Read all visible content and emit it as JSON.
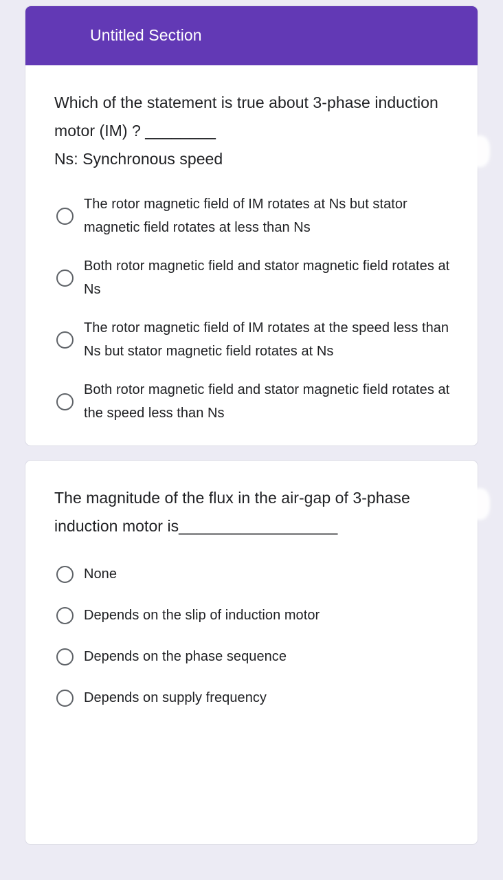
{
  "theme": {
    "page_background": "#ecebf4",
    "card_background": "#ffffff",
    "section_header_color": "#6239b5",
    "text_color": "#202124",
    "radio_border_color": "#5f6368"
  },
  "section": {
    "title": "Untitled Section"
  },
  "questions": [
    {
      "id": "q1",
      "text": "Which of the statement is true about 3-phase induction motor (IM) ? ________\n Ns: Synchronous speed",
      "options": [
        {
          "label": "The rotor magnetic field of IM rotates at Ns but stator magnetic field rotates at less than Ns",
          "selected": false
        },
        {
          "label": "Both rotor magnetic field and stator magnetic field rotates at Ns",
          "selected": false
        },
        {
          "label": "The rotor magnetic field of IM rotates at the speed less than Ns but stator magnetic field rotates at Ns",
          "selected": false
        },
        {
          "label": "Both rotor magnetic field and stator magnetic field rotates at the speed less than Ns",
          "selected": false
        }
      ]
    },
    {
      "id": "q2",
      "text": "The magnitude of the flux in the air-gap of 3-phase induction motor is__________________",
      "options": [
        {
          "label": "None",
          "selected": false
        },
        {
          "label": "Depends on the slip of induction motor",
          "selected": false
        },
        {
          "label": "Depends on the phase sequence",
          "selected": false
        },
        {
          "label": "Depends on supply frequency",
          "selected": false
        }
      ]
    }
  ]
}
